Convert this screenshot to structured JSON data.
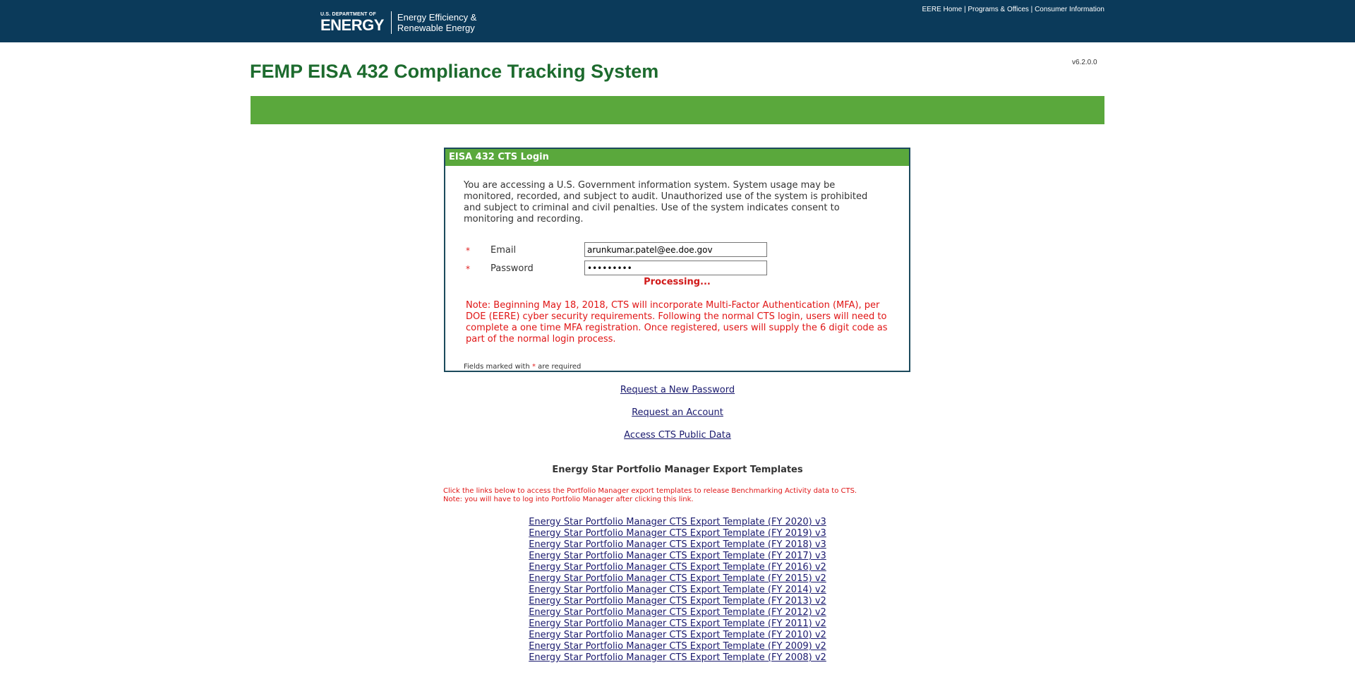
{
  "header": {
    "logo_small": "U.S. DEPARTMENT OF",
    "logo_big": "ENERGY",
    "logo_eere_line1": "Energy Efficiency &",
    "logo_eere_line2": "Renewable Energy",
    "nav": [
      "EERE Home",
      "Programs & Offices",
      "Consumer Information"
    ],
    "nav_separator": "|",
    "background_color": "#0b3a5a"
  },
  "version": "v6.2.0.0",
  "page_title": "FEMP EISA 432 Compliance Tracking System",
  "accent_color": "#5aa83c",
  "title_color": "#1d6b2e",
  "login": {
    "header": "EISA 432 CTS Login",
    "notice": "You are accessing a U.S. Government information system. System usage may be monitored, recorded, and subject to audit. Unauthorized use of the system is prohibited and subject to criminal and civil penalties. Use of the system indicates consent to monitoring and recording.",
    "required_marker": "*",
    "email_label": "Email",
    "email_value": "arunkumar.patel@ee.doe.gov",
    "password_label": "Password",
    "password_value": "•••••••••",
    "processing": "Processing...",
    "mfa_note": "Note: Beginning May 18, 2018, CTS will incorporate Multi-Factor Authentication (MFA), per DOE (EERE) cyber security requirements. Following the normal CTS login, users will need to complete a one time MFA registration. Once registered, users will supply the 6 digit code as part of the normal login process.",
    "required_note_prefix": "Fields marked with",
    "required_note_suffix": "are required"
  },
  "links": {
    "new_password": "Request a New Password",
    "request_account": "Request an Account",
    "public_data": "Access CTS Public Data"
  },
  "templates": {
    "heading": "Energy Star Portfolio Manager Export Templates",
    "info_line1": "Click the links below to access the Portfolio Manager export templates to release Benchmarking Activity data to CTS.",
    "info_line2": "Note: you will have to log into Portfolio Manager after clicking this link.",
    "items": [
      "Energy Star Portfolio Manager CTS Export Template (FY 2020) v3",
      "Energy Star Portfolio Manager CTS Export Template (FY 2019) v3",
      "Energy Star Portfolio Manager CTS Export Template (FY 2018) v3",
      "Energy Star Portfolio Manager CTS Export Template (FY 2017) v3",
      "Energy Star Portfolio Manager CTS Export Template (FY 2016) v2",
      "Energy Star Portfolio Manager CTS Export Template (FY 2015) v2",
      "Energy Star Portfolio Manager CTS Export Template (FY 2014) v2",
      "Energy Star Portfolio Manager CTS Export Template (FY 2013) v2",
      "Energy Star Portfolio Manager CTS Export Template (FY 2012) v2",
      "Energy Star Portfolio Manager CTS Export Template (FY 2011) v2",
      "Energy Star Portfolio Manager CTS Export Template (FY 2010) v2",
      "Energy Star Portfolio Manager CTS Export Template (FY 2009) v2",
      "Energy Star Portfolio Manager CTS Export Template (FY 2008) v2"
    ]
  }
}
